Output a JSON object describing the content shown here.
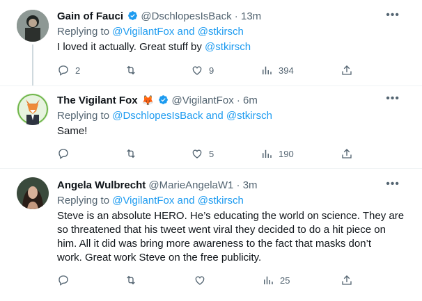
{
  "tweets": [
    {
      "name": "Gain of Fauci",
      "handle": "@DschlopesIsBack",
      "time": "13m",
      "reply_prefix": "Replying to ",
      "reply_targets": "@VigilantFox and @stkirsch",
      "text_prefix": "I loved it actually.  Great stuff by ",
      "text_link": "@stkirsch",
      "replies": "2",
      "retweets": "",
      "likes": "9",
      "views": "394"
    },
    {
      "name": "The Vigilant Fox",
      "emoji": "🦊",
      "handle": "@VigilantFox",
      "time": "6m",
      "reply_prefix": "Replying to ",
      "reply_targets": "@DschlopesIsBack and @stkirsch",
      "text": "Same!",
      "replies": "",
      "retweets": "",
      "likes": "5",
      "views": "190"
    },
    {
      "name": "Angela Wulbrecht",
      "handle": "@MarieAngelaW1",
      "time": "3m",
      "reply_prefix": "Replying to ",
      "reply_targets": "@VigilantFox and @stkirsch",
      "text_lines": [
        "Steve is an absolute HERO. He’s educating the world on science. They are",
        "so threatened that his tweet went viral they decided to do a hit piece on",
        "him. All it did was bring more awareness to the fact that masks don’t",
        "work. Great work Steve on the free publicity."
      ],
      "replies": "",
      "retweets": "",
      "likes": "",
      "views": "25"
    }
  ],
  "separator": " · ",
  "more_label": "•••",
  "colors": {
    "link": "#1d9bf0",
    "muted": "#536471",
    "verified": "#1d9bf0"
  },
  "icons": [
    "reply-icon",
    "retweet-icon",
    "like-icon",
    "views-icon",
    "share-icon",
    "verified-badge-icon",
    "more-icon"
  ]
}
